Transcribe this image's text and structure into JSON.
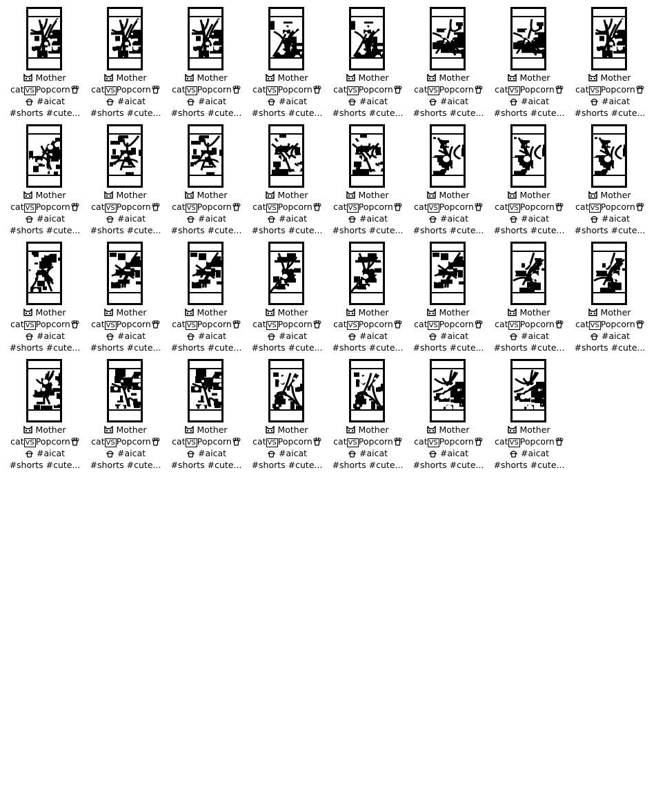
{
  "video_card_caption": {
    "line1": "Mother",
    "line2_left": "cat",
    "line2_vs": "VS",
    "line2_right": "Popcorn",
    "line3": "#aicat",
    "line4": "#shorts #cute..."
  },
  "icons": {
    "line1": "cat-face-icon",
    "line2": "popcorn-icon",
    "line3": "cupcake-icon"
  },
  "tiles": [
    {
      "art": "a"
    },
    {
      "art": "a"
    },
    {
      "art": "a"
    },
    {
      "art": "b"
    },
    {
      "art": "b"
    },
    {
      "art": "c"
    },
    {
      "art": "c"
    },
    {
      "art": "a"
    },
    {
      "art": "d"
    },
    {
      "art": "e"
    },
    {
      "art": "e"
    },
    {
      "art": "f"
    },
    {
      "art": "f"
    },
    {
      "art": "g"
    },
    {
      "art": "g"
    },
    {
      "art": "g"
    },
    {
      "art": "h"
    },
    {
      "art": "i"
    },
    {
      "art": "i"
    },
    {
      "art": "j"
    },
    {
      "art": "j"
    },
    {
      "art": "i"
    },
    {
      "art": "k"
    },
    {
      "art": "k"
    },
    {
      "art": "l"
    },
    {
      "art": "m"
    },
    {
      "art": "m"
    },
    {
      "art": "n"
    },
    {
      "art": "n"
    },
    {
      "art": "o"
    },
    {
      "art": "o"
    }
  ]
}
